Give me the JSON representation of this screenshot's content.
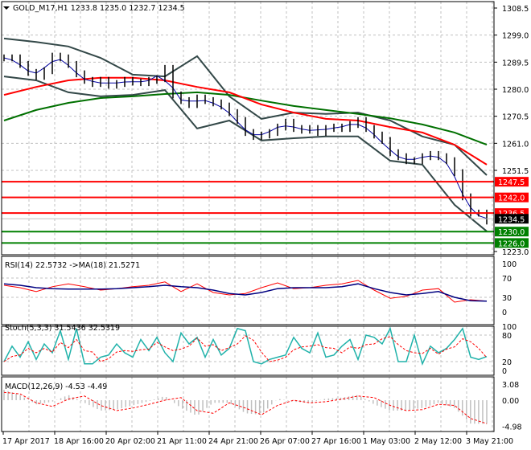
{
  "header": {
    "symbol_info": "GOLD_M17,H1  1233.8 1235.0 1232.7 1234.5"
  },
  "colors": {
    "candle": "#000000",
    "ma_fast": "#ff0000",
    "ma_slow": "#007000",
    "bands": "#334848",
    "level_red": "#ff0000",
    "level_green": "#008000",
    "rsi": "#ff0000",
    "rsi_ma": "#000080",
    "stoch_main": "#20b2aa",
    "stoch_signal": "#ff0000",
    "macd_hist": "#c0c0c0",
    "macd_signal": "#ff0000"
  },
  "chart_data": [
    {
      "type": "line",
      "title": "GOLD_M17,H1",
      "ohlc_last": {
        "open": 1233.8,
        "high": 1235.0,
        "low": 1232.7,
        "close": 1234.5
      },
      "ylim": [
        1223.0,
        1308.5
      ],
      "y_ticks": [
        "1308.5",
        "1299.0",
        "1289.5",
        "1280.0",
        "1270.5",
        "1261.0",
        "1251.5",
        "1223.0"
      ],
      "close": [
        1291.0,
        1291.0,
        1288.7,
        1285.9,
        1284.5,
        1286.5,
        1291.6,
        1291.0,
        1288.7,
        1285.4,
        1283.1,
        1282.0,
        1283.1,
        1281.4,
        1282.0,
        1283.1,
        1282.5,
        1282.3,
        1283.1,
        1283.7,
        1287.3,
        1278.0,
        1276.0,
        1274.6,
        1276.9,
        1276.0,
        1275.2,
        1274.1,
        1271.8,
        1269.0,
        1264.8,
        1263.4,
        1263.9,
        1264.8,
        1266.7,
        1268.4,
        1266.2,
        1265.6,
        1266.2,
        1264.8,
        1266.2,
        1266.7,
        1266.2,
        1267.6,
        1269.0,
        1266.2,
        1263.9,
        1262.0,
        1257.7,
        1256.3,
        1254.9,
        1254.9,
        1256.3,
        1257.1,
        1256.3,
        1254.9,
        1250.7,
        1242.2,
        1236.5,
        1236.5,
        1233.7
      ],
      "ma_red": [
        1278.0,
        1280.8,
        1283.1,
        1284.0,
        1284.0,
        1283.1,
        1280.8,
        1278.9,
        1274.6,
        1271.8,
        1269.6,
        1269.0,
        1266.7,
        1264.8,
        1260.5,
        1253.5
      ],
      "ma_green": [
        1269.0,
        1272.7,
        1275.2,
        1276.9,
        1277.5,
        1278.3,
        1278.9,
        1278.0,
        1276.0,
        1274.1,
        1272.7,
        1271.3,
        1269.8,
        1267.6,
        1264.8,
        1260.5
      ],
      "band_upper": [
        1297.8,
        1296.6,
        1295.0,
        1291.0,
        1285.1,
        1284.5,
        1291.6,
        1277.5,
        1269.6,
        1271.8,
        1271.3,
        1271.8,
        1269.0,
        1263.4,
        1260.5,
        1249.8
      ],
      "band_lower": [
        1284.5,
        1283.1,
        1278.9,
        1277.5,
        1278.0,
        1279.7,
        1266.2,
        1269.0,
        1262.0,
        1262.8,
        1263.4,
        1263.4,
        1254.9,
        1253.5,
        1239.4,
        1230.1
      ],
      "levels": [
        {
          "value": 1247.5,
          "label": "1247.5",
          "color": "red"
        },
        {
          "value": 1242.0,
          "label": "1242.0",
          "color": "red"
        },
        {
          "value": 1236.5,
          "label": "1236.5",
          "color": "red"
        },
        {
          "value": 1230.0,
          "label": "1230.0",
          "color": "green"
        },
        {
          "value": 1226.0,
          "label": "1226.0",
          "color": "green"
        }
      ],
      "current_price": {
        "value": 1234.5,
        "label": "1234.5"
      }
    },
    {
      "type": "line",
      "title": "RSI(14) 22.5732  ->MA(18) 21.5271",
      "ylim": [
        0,
        100
      ],
      "y_ticks": [
        "100",
        "70",
        "30",
        "0"
      ],
      "rsi": [
        55,
        50,
        42,
        52,
        58,
        52,
        45,
        48,
        52,
        55,
        62,
        42,
        58,
        40,
        35,
        38,
        50,
        60,
        48,
        50,
        55,
        58,
        65,
        45,
        28,
        32,
        45,
        48,
        20,
        25,
        22
      ],
      "rsi_ma": [
        58,
        55,
        50,
        48,
        47,
        47,
        47,
        48,
        50,
        52,
        55,
        52,
        50,
        45,
        38,
        35,
        40,
        48,
        50,
        50,
        50,
        52,
        58,
        48,
        40,
        35,
        38,
        42,
        30,
        23,
        22
      ]
    },
    {
      "type": "line",
      "title": "Stoch(5,3,3) 31.5436 32.5319",
      "ylim": [
        0,
        100
      ],
      "y_ticks": [
        "100",
        "80",
        "20",
        "0"
      ],
      "main": [
        20,
        55,
        30,
        65,
        25,
        60,
        40,
        90,
        25,
        95,
        15,
        15,
        30,
        35,
        60,
        40,
        30,
        70,
        45,
        75,
        40,
        20,
        85,
        60,
        75,
        30,
        70,
        35,
        50,
        95,
        90,
        20,
        15,
        25,
        30,
        35,
        75,
        50,
        40,
        85,
        30,
        35,
        55,
        70,
        25,
        80,
        75,
        60,
        95,
        20,
        20,
        80,
        15,
        55,
        40,
        50,
        70,
        95,
        30,
        25,
        31.5
      ]
    },
    {
      "type": "bar",
      "title": "MACD(12,26,9) -4.53 -4.49",
      "ylim": [
        -4.98,
        3.08
      ],
      "y_ticks": [
        "3.08",
        "0.00",
        "-4.98"
      ],
      "histogram": [
        2.0,
        1.0,
        -0.8,
        -0.3,
        1.0,
        -0.5,
        -2.0,
        -1.8,
        -1.0,
        -0.2,
        0.8,
        -1.5,
        -3.0,
        -0.5,
        -0.5,
        -2.5,
        -2.8,
        0.3,
        -0.3,
        -0.5,
        0.3,
        0.5,
        1.0,
        -0.8,
        -2.0,
        -2.0,
        -1.5,
        -0.5,
        -1.5,
        -4.5,
        -4.53
      ],
      "signal": [
        1.5,
        1.2,
        -0.5,
        -1.2,
        0.2,
        0.8,
        -1.0,
        -2.0,
        -1.5,
        -0.8,
        0.0,
        0.5,
        -2.0,
        -2.5,
        -0.5,
        -1.5,
        -2.8,
        -1.0,
        0.0,
        -0.5,
        -0.3,
        0.2,
        0.8,
        0.5,
        -1.0,
        -2.0,
        -1.8,
        -0.8,
        -1.0,
        -3.5,
        -4.49
      ]
    }
  ],
  "time_axis": [
    "17 Apr 2017",
    "18 Apr 16:00",
    "20 Apr 02:00",
    "21 Apr 11:00",
    "24 Apr 21:00",
    "26 Apr 07:00",
    "27 Apr 16:00",
    "1 May 03:00",
    "2 May 12:00",
    "3 May 21:00"
  ]
}
